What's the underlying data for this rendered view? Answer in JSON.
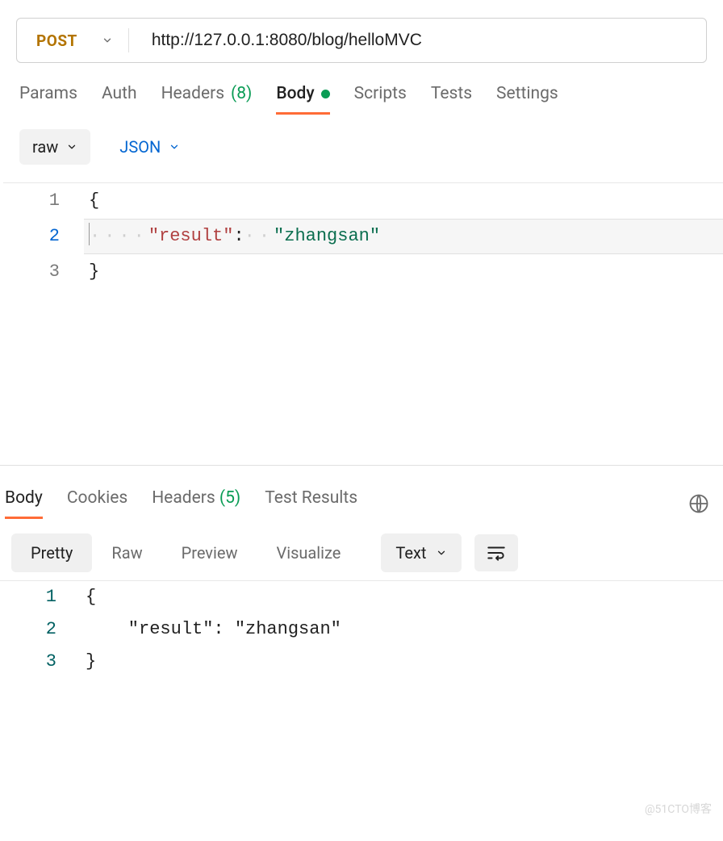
{
  "request": {
    "method": "POST",
    "url": "http://127.0.0.1:8080/blog/helloMVC"
  },
  "tabs": {
    "params": "Params",
    "auth": "Auth",
    "headers_label": "Headers",
    "headers_count": "(8)",
    "body": "Body",
    "scripts": "Scripts",
    "tests": "Tests",
    "settings": "Settings"
  },
  "body_controls": {
    "type": "raw",
    "format": "JSON"
  },
  "request_body": {
    "lines": [
      "1",
      "2",
      "3"
    ],
    "open_brace": "{",
    "key": "\"result\"",
    "colon": ":",
    "value": "\"zhangsan\"",
    "close_brace": "}"
  },
  "response_tabs": {
    "body": "Body",
    "cookies": "Cookies",
    "headers_label": "Headers",
    "headers_count": "(5)",
    "test_results": "Test Results"
  },
  "response_controls": {
    "pretty": "Pretty",
    "raw": "Raw",
    "preview": "Preview",
    "visualize": "Visualize",
    "format": "Text"
  },
  "response_body": {
    "lines": [
      "1",
      "2",
      "3"
    ],
    "open_brace": "{",
    "line2": "    \"result\": \"zhangsan\"",
    "close_brace": "}"
  },
  "watermark": "@51CTO博客"
}
